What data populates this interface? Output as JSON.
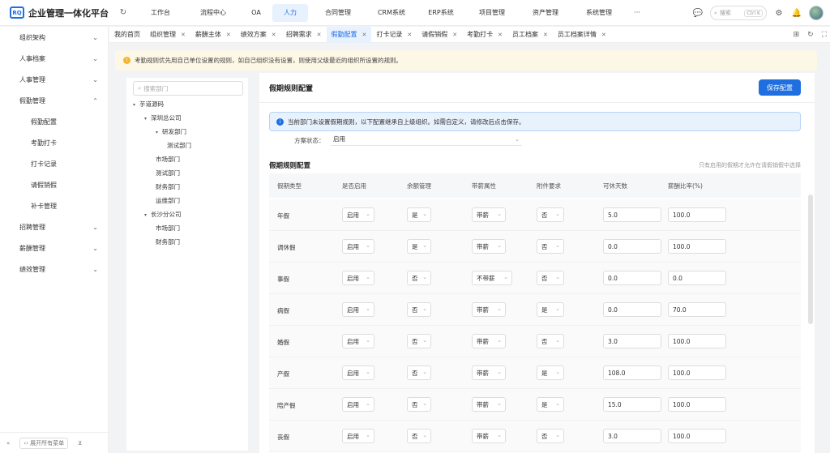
{
  "app": {
    "logo": "RQ",
    "title": "企业管理一体化平台"
  },
  "topnav": [
    "工作台",
    "流程中心",
    "OA",
    "人力",
    "合同管理",
    "CRM系统",
    "ERP系统",
    "项目管理",
    "资产管理",
    "系统管理",
    "···"
  ],
  "topnav_active": "人力",
  "search": {
    "placeholder": "搜索",
    "shortcut": "Ctrl K"
  },
  "sidebar": {
    "items": [
      {
        "label": "组织架构",
        "arrow": "⌄"
      },
      {
        "label": "人事档案",
        "arrow": "⌄"
      },
      {
        "label": "人事管理",
        "arrow": "⌄"
      },
      {
        "label": "假勤管理",
        "arrow": "⌃"
      }
    ],
    "sub_items": [
      "假勤配置",
      "考勤打卡",
      "打卡记录",
      "请假销假",
      "补卡管理"
    ],
    "items_after": [
      {
        "label": "招聘管理",
        "arrow": "⌄"
      },
      {
        "label": "薪酬管理",
        "arrow": "⌄"
      },
      {
        "label": "绩效管理",
        "arrow": "⌄"
      }
    ],
    "footer": {
      "expand_label": "‹› 展开所有菜单"
    }
  },
  "tabs": [
    {
      "label": "我的首页",
      "closable": false
    },
    {
      "label": "组织管理",
      "closable": true
    },
    {
      "label": "薪酬主体",
      "closable": true
    },
    {
      "label": "绩效方案",
      "closable": true
    },
    {
      "label": "招聘需求",
      "closable": true
    },
    {
      "label": "假勤配置",
      "closable": true
    },
    {
      "label": "打卡记录",
      "closable": true
    },
    {
      "label": "请假销假",
      "closable": true
    },
    {
      "label": "考勤打卡",
      "closable": true
    },
    {
      "label": "员工档案",
      "closable": true
    },
    {
      "label": "员工档案详情",
      "closable": true
    }
  ],
  "tabs_active": "假勤配置",
  "notice": "考勤规则优先用自己单位设置的规则，如自己组织没有设置，则使用父级最近的组织所设置的规则。",
  "tree": {
    "search_placeholder": "搜索部门",
    "nodes": [
      {
        "label": "芋道源码",
        "level": 0,
        "caret": true
      },
      {
        "label": "深圳总公司",
        "level": 1,
        "caret": true
      },
      {
        "label": "研发部门",
        "level": 2,
        "caret": true
      },
      {
        "label": "测试部门",
        "level": 3,
        "caret": false
      },
      {
        "label": "市场部门",
        "level": 2,
        "caret": false
      },
      {
        "label": "测试部门",
        "level": 2,
        "caret": false
      },
      {
        "label": "财务部门",
        "level": 2,
        "caret": false
      },
      {
        "label": "运维部门",
        "level": 2,
        "caret": false
      },
      {
        "label": "长沙分公司",
        "level": 1,
        "caret": true
      },
      {
        "label": "市场部门",
        "level": 2,
        "caret": false
      },
      {
        "label": "财务部门",
        "level": 2,
        "caret": false
      }
    ]
  },
  "main": {
    "title": "假期规则配置",
    "save_label": "保存配置",
    "info": "当前部门未设置假期规则，以下配置继承自上级组织。如需自定义，请修改后点击保存。",
    "status_label": "方案状态：",
    "status_value": "启用",
    "section_title": "假期规则配置",
    "section_hint": "只有启用的假期才允许在请假销假中选择",
    "columns": [
      "假期类型",
      "是否启用",
      "余额管理",
      "带薪属性",
      "附件要求",
      "可休天数",
      "薪酬比率(%)"
    ],
    "rows": [
      {
        "type": "年假",
        "enabled": "启用",
        "balance": "是",
        "paid": "带薪",
        "attach": "否",
        "days": "5.0",
        "ratio": "100.0"
      },
      {
        "type": "调休假",
        "enabled": "启用",
        "balance": "是",
        "paid": "带薪",
        "attach": "否",
        "days": "0.0",
        "ratio": "100.0"
      },
      {
        "type": "事假",
        "enabled": "启用",
        "balance": "否",
        "paid": "不带薪",
        "attach": "否",
        "days": "0.0",
        "ratio": "0.0"
      },
      {
        "type": "病假",
        "enabled": "启用",
        "balance": "否",
        "paid": "带薪",
        "attach": "是",
        "days": "0.0",
        "ratio": "70.0"
      },
      {
        "type": "婚假",
        "enabled": "启用",
        "balance": "否",
        "paid": "带薪",
        "attach": "否",
        "days": "3.0",
        "ratio": "100.0"
      },
      {
        "type": "产假",
        "enabled": "启用",
        "balance": "否",
        "paid": "带薪",
        "attach": "是",
        "days": "108.0",
        "ratio": "100.0"
      },
      {
        "type": "陪产假",
        "enabled": "启用",
        "balance": "否",
        "paid": "带薪",
        "attach": "是",
        "days": "15.0",
        "ratio": "100.0"
      },
      {
        "type": "丧假",
        "enabled": "启用",
        "balance": "否",
        "paid": "带薪",
        "attach": "否",
        "days": "3.0",
        "ratio": "100.0"
      }
    ]
  },
  "colors": {
    "primary": "#1f6fe0",
    "notice_bg": "#fdf7e6",
    "info_bg": "#e8f2fd"
  }
}
